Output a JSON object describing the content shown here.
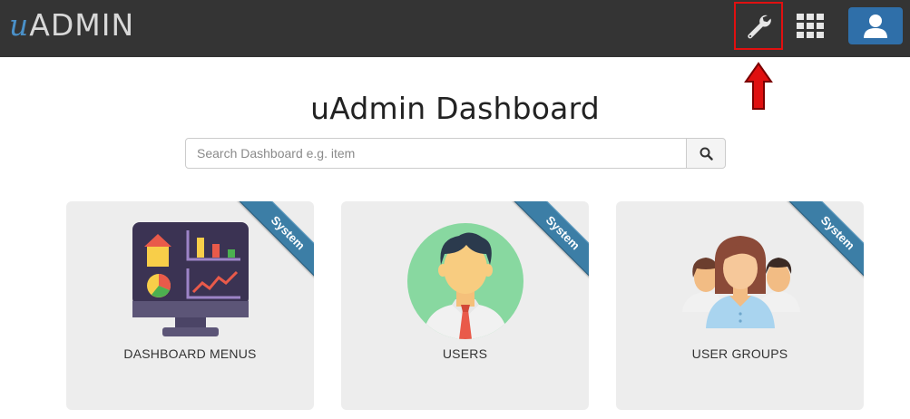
{
  "header": {
    "brand_prefix": "u",
    "brand_suffix": "ADMIN",
    "icons": {
      "settings": "wrench-icon",
      "apps": "grid-icon",
      "profile": "user-icon"
    },
    "colors": {
      "navbar": "#343434",
      "profile_button": "#2f6fa9",
      "highlight": "#e01010"
    }
  },
  "page": {
    "title": "uAdmin Dashboard"
  },
  "search": {
    "placeholder": "Search Dashboard e.g. item",
    "value": "",
    "button_icon": "search-icon"
  },
  "cards": [
    {
      "label": "DASHBOARD MENUS",
      "ribbon": "System",
      "icon": "dashboard-monitor-icon"
    },
    {
      "label": "USERS",
      "ribbon": "System",
      "icon": "user-avatar-icon"
    },
    {
      "label": "USER GROUPS",
      "ribbon": "System",
      "icon": "user-group-icon"
    }
  ],
  "annotation": {
    "icon": "red-up-arrow-icon",
    "color": "#e01010"
  }
}
